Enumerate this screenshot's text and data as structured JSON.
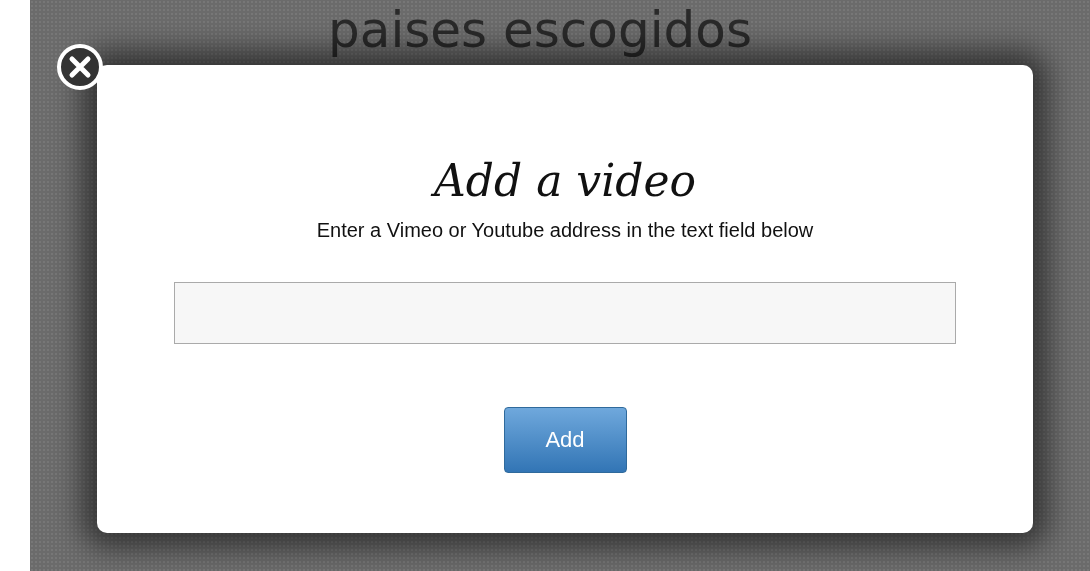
{
  "background": {
    "heading": "paises escogidos"
  },
  "dialog": {
    "title": "Add a video",
    "instructions": "Enter a Vimeo or Youtube address in the text field below",
    "submit_button": "Add"
  }
}
